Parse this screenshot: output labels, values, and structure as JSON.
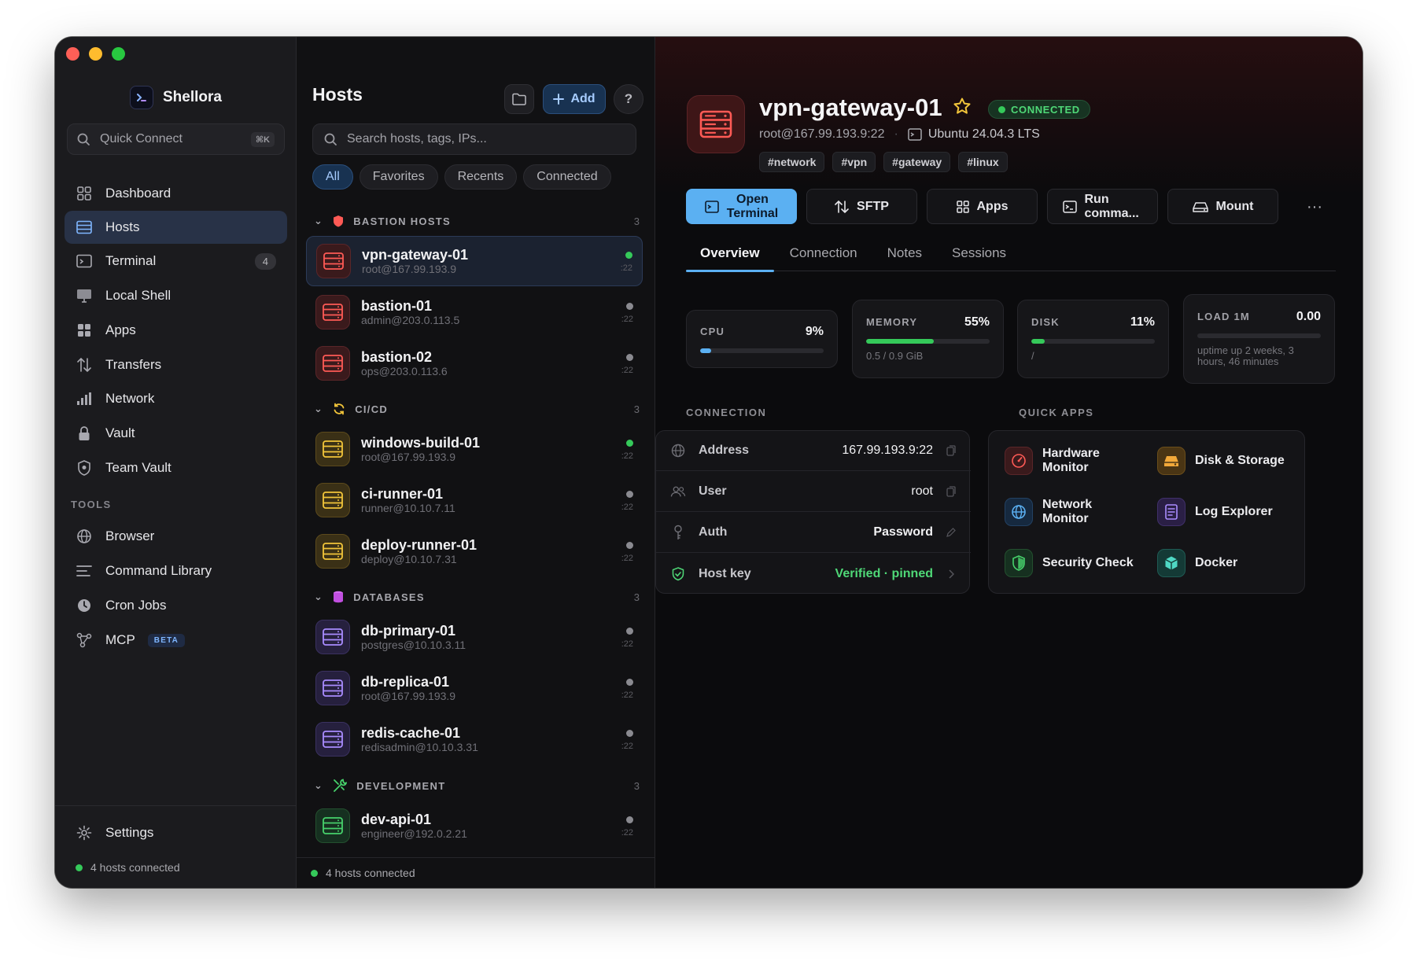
{
  "app": {
    "name": "Shellora"
  },
  "sidebar": {
    "quick_connect": {
      "placeholder": "Quick Connect",
      "shortcut": "⌘K"
    },
    "items": [
      {
        "label": "Dashboard",
        "icon": "grid-icon"
      },
      {
        "label": "Hosts",
        "icon": "server-icon",
        "active": true
      },
      {
        "label": "Terminal",
        "icon": "terminal-icon",
        "badge": "4"
      },
      {
        "label": "Local Shell",
        "icon": "monitor-icon"
      },
      {
        "label": "Apps",
        "icon": "apps-icon"
      },
      {
        "label": "Transfers",
        "icon": "transfer-icon"
      },
      {
        "label": "Network",
        "icon": "signal-icon"
      },
      {
        "label": "Vault",
        "icon": "lock-icon"
      },
      {
        "label": "Team Vault",
        "icon": "shield-icon"
      }
    ],
    "tools_label": "TOOLS",
    "tools": [
      {
        "label": "Browser",
        "icon": "globe-icon"
      },
      {
        "label": "Command Library",
        "icon": "list-icon"
      },
      {
        "label": "Cron Jobs",
        "icon": "clock-icon"
      },
      {
        "label": "MCP",
        "icon": "nodes-icon",
        "badge": "BETA"
      }
    ],
    "settings_label": "Settings",
    "status": "4 hosts connected"
  },
  "hosts": {
    "title": "Hosts",
    "add_label": "Add",
    "search_placeholder": "Search hosts, tags, IPs...",
    "filters": [
      "All",
      "Favorites",
      "Recents",
      "Connected"
    ],
    "groups": [
      {
        "name": "BASTION HOSTS",
        "count": "3",
        "hosts": [
          {
            "name": "vpn-gateway-01",
            "addr": "root@167.99.193.9",
            "port": ":22",
            "online": true
          },
          {
            "name": "bastion-01",
            "addr": "admin@203.0.113.5",
            "port": ":22",
            "online": false
          },
          {
            "name": "bastion-02",
            "addr": "ops@203.0.113.6",
            "port": ":22",
            "online": false
          }
        ]
      },
      {
        "name": "CI/CD",
        "count": "3",
        "hosts": [
          {
            "name": "windows-build-01",
            "addr": "root@167.99.193.9",
            "port": ":22",
            "online": true
          },
          {
            "name": "ci-runner-01",
            "addr": "runner@10.10.7.11",
            "port": ":22",
            "online": false
          },
          {
            "name": "deploy-runner-01",
            "addr": "deploy@10.10.7.31",
            "port": ":22",
            "online": false
          }
        ]
      },
      {
        "name": "DATABASES",
        "count": "3",
        "hosts": [
          {
            "name": "db-primary-01",
            "addr": "postgres@10.10.3.11",
            "port": ":22",
            "online": false
          },
          {
            "name": "db-replica-01",
            "addr": "root@167.99.193.9",
            "port": ":22",
            "online": false
          },
          {
            "name": "redis-cache-01",
            "addr": "redisadmin@10.10.3.31",
            "port": ":22",
            "online": false
          }
        ]
      },
      {
        "name": "DEVELOPMENT",
        "count": "3",
        "hosts": [
          {
            "name": "dev-api-01",
            "addr": "engineer@192.0.2.21",
            "port": ":22",
            "online": false
          }
        ]
      }
    ],
    "status": "4 hosts connected"
  },
  "detail": {
    "title": "vpn-gateway-01",
    "status": "CONNECTED",
    "user_host": "root@167.99.193.9:22",
    "os": "Ubuntu 24.04.3 LTS",
    "tags": [
      "#network",
      "#vpn",
      "#gateway",
      "#linux"
    ],
    "actions": [
      {
        "label": "Open Terminal",
        "icon": "terminal-icon"
      },
      {
        "label": "SFTP",
        "icon": "transfer-icon"
      },
      {
        "label": "Apps",
        "icon": "apps-icon"
      },
      {
        "label": "Run comma...",
        "icon": "command-icon"
      },
      {
        "label": "Mount",
        "icon": "drive-icon"
      }
    ],
    "more_label": "···",
    "tabs": [
      "Overview",
      "Connection",
      "Notes",
      "Sessions"
    ],
    "stats": {
      "cpu": {
        "label": "CPU",
        "value": "9%",
        "fraction": 0.09,
        "color": "#5bb0f2"
      },
      "memory": {
        "label": "MEMORY",
        "value": "55%",
        "fraction": 0.55,
        "note": "0.5 / 0.9 GiB",
        "color": "#35c95a"
      },
      "disk": {
        "label": "DISK",
        "value": "11%",
        "fraction": 0.11,
        "note": "/",
        "color": "#35c95a"
      },
      "load": {
        "label": "LOAD 1M",
        "value": "0.00",
        "fraction": 0.0,
        "note": "uptime up 2 weeks, 3 hours, 46 minutes",
        "color": "#5bb0f2"
      }
    },
    "connection_label": "CONNECTION",
    "connection": [
      {
        "key": "Address",
        "value": "167.99.193.9:22",
        "icon": "globe-icon",
        "trail": "copy-icon"
      },
      {
        "key": "User",
        "value": "root",
        "icon": "users-icon",
        "trail": "copy-icon"
      },
      {
        "key": "Auth",
        "value": "Password",
        "icon": "key-icon",
        "trail": "edit-icon"
      },
      {
        "key": "Host key",
        "value": "Verified · pinned",
        "icon": "shield-check-icon",
        "trail": "chevron-right-icon"
      }
    ],
    "quick_apps_label": "QUICK APPS",
    "quick_apps": [
      {
        "label": "Hardware Monitor",
        "icon": "gauge-icon"
      },
      {
        "label": "Disk & Storage",
        "icon": "drive-icon"
      },
      {
        "label": "Network Monitor",
        "icon": "globe-icon"
      },
      {
        "label": "Log Explorer",
        "icon": "log-icon"
      },
      {
        "label": "Security Check",
        "icon": "shield-icon"
      },
      {
        "label": "Docker",
        "icon": "cube-icon"
      }
    ]
  }
}
